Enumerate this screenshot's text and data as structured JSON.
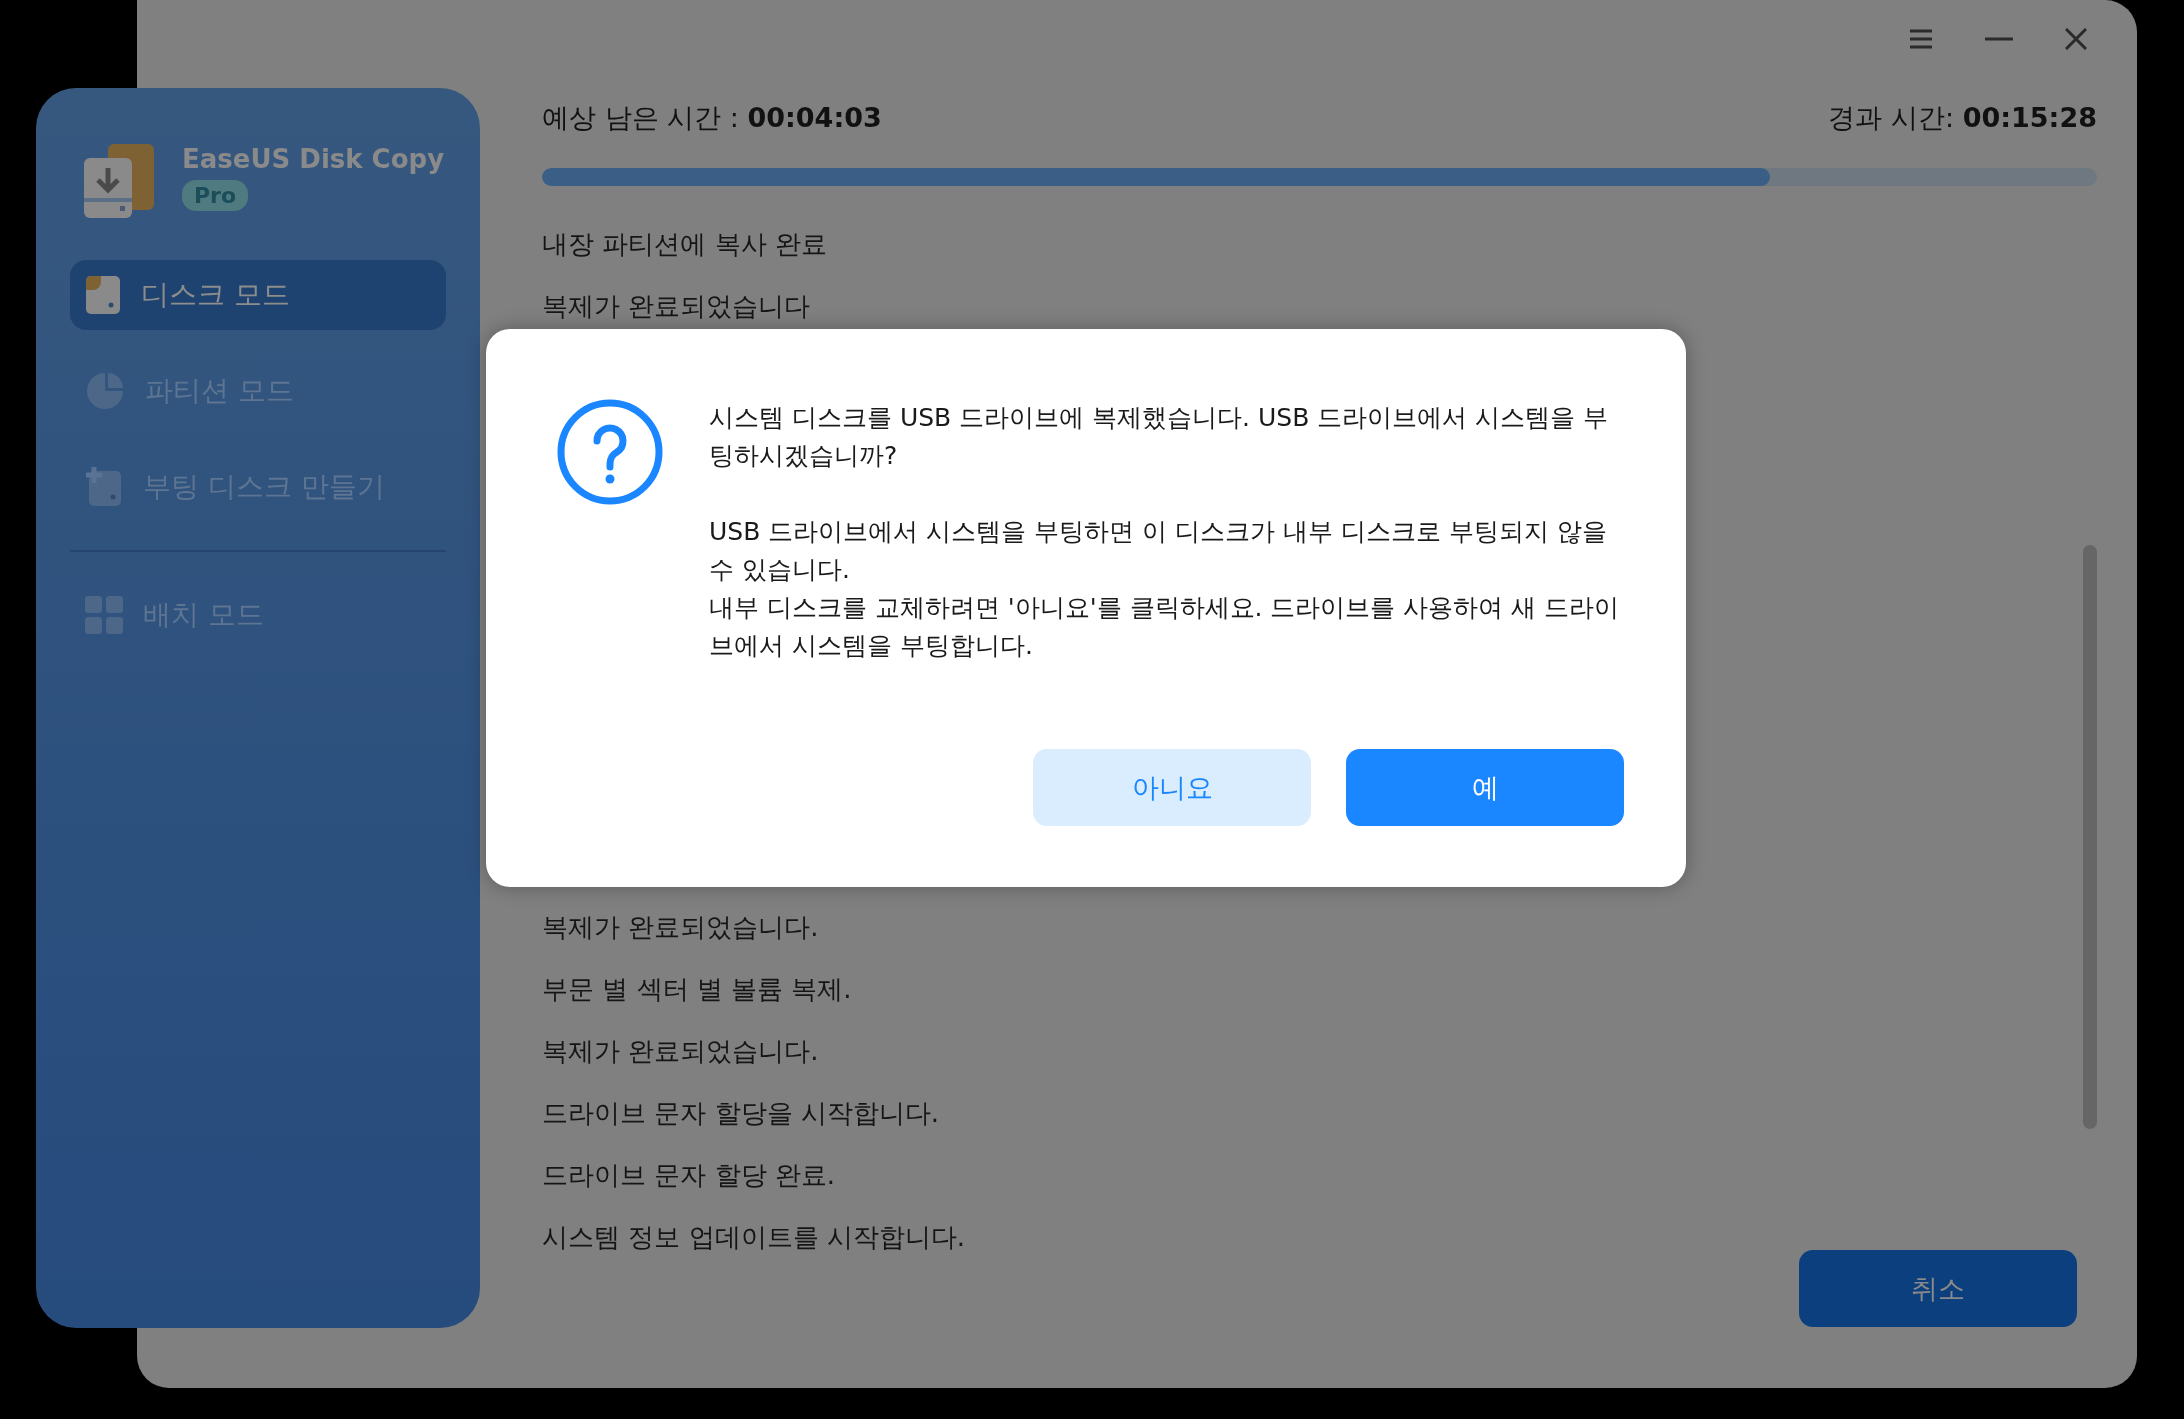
{
  "sidebar": {
    "app_name": "EaseUS Disk Copy",
    "edition_badge": "Pro",
    "items": [
      {
        "label": "디스크 모드",
        "kind": "disk",
        "selected": true
      },
      {
        "label": "파티션 모드",
        "kind": "partition",
        "selected": false
      },
      {
        "label": "부팅 디스크 만들기",
        "kind": "boot",
        "selected": false
      },
      {
        "label": "배치 모드",
        "kind": "batch",
        "selected": false,
        "divider_before": true
      }
    ]
  },
  "window_controls": [
    {
      "kind": "menu"
    },
    {
      "kind": "minimize"
    },
    {
      "kind": "close"
    }
  ],
  "progress": {
    "remaining": "예상 남은 시간 : **00:04:03**",
    "elapsed": "경과 시간: **00:15:28**",
    "level": 0.79
  },
  "log_top": [
    "내장 파티션에 복사 완료",
    "복제가 완료되었습니다"
  ],
  "log_bottom": [
    "복제가 완료되었습니다.",
    "부문 별 섹터 별 볼륨 복제.",
    "복제가 완료되었습니다.",
    "드라이브 문자 할당을 시작합니다.",
    "드라이브 문자 할당 완료.",
    "시스템 정보 업데이트를 시작합니다."
  ],
  "cancel_button": "취소",
  "dialog": {
    "paragraphs": [
      "시스템 디스크를 USB 드라이브에 복제했습니다. USB 드라이브에서 시스템을 부팅하시겠습니까?",
      "USB 드라이브에서 시스템을 부팅하면 이 디스크가 내부 디스크로 부팅되지 않을 수 있습니다.\n내부 디스크를 교체하려면 '아니요'를 클릭하세요. 드라이브를 사용하여 새 드라이브에서 시스템을 부팅합니다."
    ],
    "buttons": [
      {
        "label": "아니요",
        "kind": "secondary"
      },
      {
        "label": "예",
        "kind": "primary"
      }
    ]
  }
}
